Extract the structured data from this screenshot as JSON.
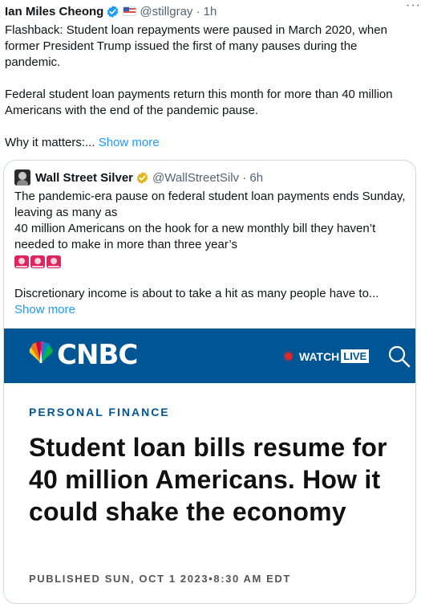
{
  "author": {
    "name": "Ian Miles Cheong",
    "handle": "@stillgray",
    "time": "· 1h",
    "more": "···"
  },
  "tweet": {
    "para1": "Flashback: Student loan repayments were paused in March 2020, when former President Trump issued the first of many pauses during the pandemic.",
    "para2": "Federal student loan payments return this month for more than 40 million Americans with the end of the pandemic pause.",
    "para3_text": "Why it matters:...",
    "show_more": "Show more"
  },
  "quote": {
    "name": "Wall Street Silver",
    "handle": "@WallStreetSilv · 6h",
    "line1": "The pandemic-era pause on federal student loan payments ends Sunday, leaving as many as",
    "line2": "40 million Americans on the hook for a new monthly bill they haven’t needed to make in more than three year’s",
    "para2_text": "Discretionary income is about to take a hit as many people have to...",
    "show_more": "Show more",
    "sirens": [
      "siren-icon",
      "siren-icon",
      "siren-icon"
    ]
  },
  "card": {
    "brand": "CNBC",
    "watch_label": "WATCH",
    "live_label": "LIVE",
    "section": "PERSONAL FINANCE",
    "headline": "Student loan bills resume for 40 million Americans. How it could shake the economy",
    "published": "PUBLISHED SUN, OCT 1 2023•8:30 AM EDT"
  },
  "colors": {
    "cnbc_blue": "#005594",
    "link_blue": "#1d9bf0",
    "verified_blue": "#1d9bf0",
    "verified_gold": "#e2b719",
    "live_red": "#e4252a"
  }
}
